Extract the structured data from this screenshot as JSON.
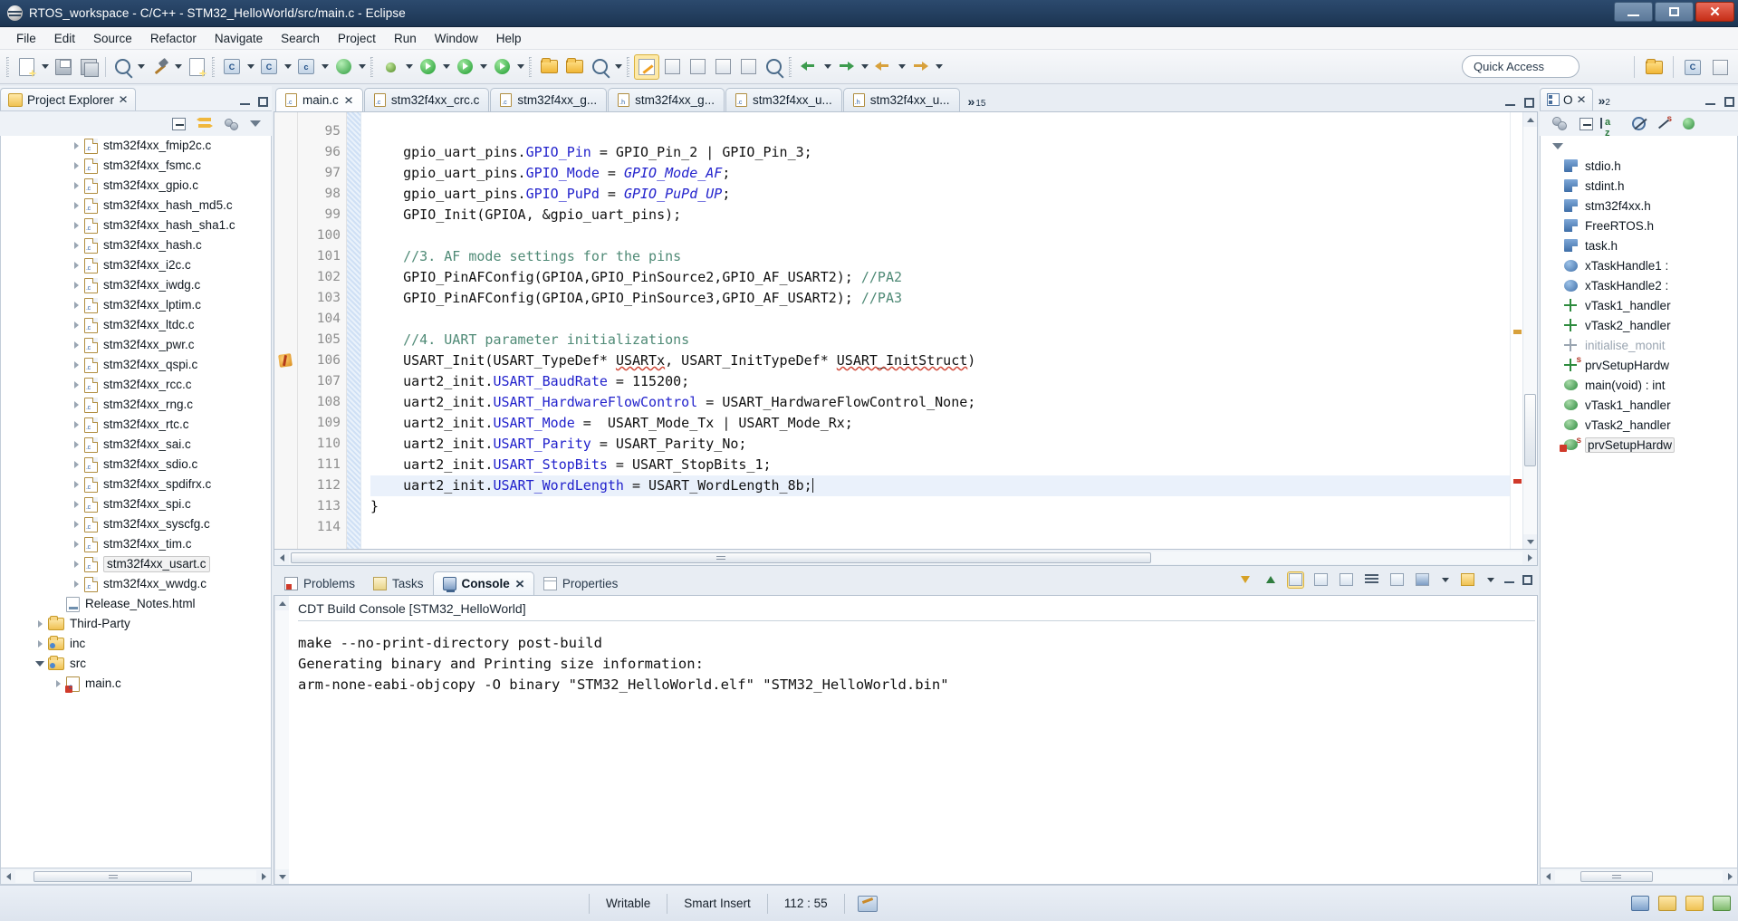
{
  "window": {
    "title": "RTOS_workspace - C/C++ - STM32_HelloWorld/src/main.c - Eclipse",
    "minimize_label": "",
    "maximize_label": "",
    "close_label": "✕"
  },
  "menu": {
    "items": [
      "File",
      "Edit",
      "Source",
      "Refactor",
      "Navigate",
      "Search",
      "Project",
      "Run",
      "Window",
      "Help"
    ]
  },
  "toolbar": {
    "quick_access_placeholder": "Quick Access",
    "buttons": [
      "new-button",
      "save-button",
      "save-all-button",
      "skip-breakpoints-button",
      "build-button",
      "binary-button",
      "new-c-project-button",
      "new-cpp-project-button",
      "new-c-file-button",
      "refresh-button",
      "debug-button",
      "run-button",
      "run-config-button",
      "external-tools-button",
      "open-folder-button",
      "search-folder-button",
      "search-button",
      "toggle-mark-button",
      "next-annotation-button",
      "previous-annotation-button",
      "last-edit-button",
      "back-button",
      "forward-button"
    ]
  },
  "project_explorer": {
    "title": "Project Explorer",
    "close_icon": "✕",
    "toolbar": [
      "collapse-all-icon",
      "link-with-editor-icon",
      "view-menu-icon",
      "view-dropdown-icon"
    ],
    "items": [
      {
        "label": "stm32f4xx_fmip2c.c",
        "indent": 3,
        "type": "c",
        "expandable": true,
        "selected": false
      },
      {
        "label": "stm32f4xx_fsmc.c",
        "indent": 3,
        "type": "c",
        "expandable": true,
        "selected": false
      },
      {
        "label": "stm32f4xx_gpio.c",
        "indent": 3,
        "type": "c",
        "expandable": true,
        "selected": false
      },
      {
        "label": "stm32f4xx_hash_md5.c",
        "indent": 3,
        "type": "c",
        "expandable": true,
        "selected": false
      },
      {
        "label": "stm32f4xx_hash_sha1.c",
        "indent": 3,
        "type": "c",
        "expandable": true,
        "selected": false
      },
      {
        "label": "stm32f4xx_hash.c",
        "indent": 3,
        "type": "c",
        "expandable": true,
        "selected": false
      },
      {
        "label": "stm32f4xx_i2c.c",
        "indent": 3,
        "type": "c",
        "expandable": true,
        "selected": false
      },
      {
        "label": "stm32f4xx_iwdg.c",
        "indent": 3,
        "type": "c",
        "expandable": true,
        "selected": false
      },
      {
        "label": "stm32f4xx_lptim.c",
        "indent": 3,
        "type": "c",
        "expandable": true,
        "selected": false
      },
      {
        "label": "stm32f4xx_ltdc.c",
        "indent": 3,
        "type": "c",
        "expandable": true,
        "selected": false
      },
      {
        "label": "stm32f4xx_pwr.c",
        "indent": 3,
        "type": "c",
        "expandable": true,
        "selected": false
      },
      {
        "label": "stm32f4xx_qspi.c",
        "indent": 3,
        "type": "c",
        "expandable": true,
        "selected": false
      },
      {
        "label": "stm32f4xx_rcc.c",
        "indent": 3,
        "type": "c",
        "expandable": true,
        "selected": false
      },
      {
        "label": "stm32f4xx_rng.c",
        "indent": 3,
        "type": "c",
        "expandable": true,
        "selected": false
      },
      {
        "label": "stm32f4xx_rtc.c",
        "indent": 3,
        "type": "c",
        "expandable": true,
        "selected": false
      },
      {
        "label": "stm32f4xx_sai.c",
        "indent": 3,
        "type": "c",
        "expandable": true,
        "selected": false
      },
      {
        "label": "stm32f4xx_sdio.c",
        "indent": 3,
        "type": "c",
        "expandable": true,
        "selected": false
      },
      {
        "label": "stm32f4xx_spdifrx.c",
        "indent": 3,
        "type": "c",
        "expandable": true,
        "selected": false
      },
      {
        "label": "stm32f4xx_spi.c",
        "indent": 3,
        "type": "c",
        "expandable": true,
        "selected": false
      },
      {
        "label": "stm32f4xx_syscfg.c",
        "indent": 3,
        "type": "c",
        "expandable": true,
        "selected": false
      },
      {
        "label": "stm32f4xx_tim.c",
        "indent": 3,
        "type": "c",
        "expandable": true,
        "selected": false
      },
      {
        "label": "stm32f4xx_usart.c",
        "indent": 3,
        "type": "c",
        "expandable": true,
        "selected": true
      },
      {
        "label": "stm32f4xx_wwdg.c",
        "indent": 3,
        "type": "c",
        "expandable": true,
        "selected": false
      },
      {
        "label": "Release_Notes.html",
        "indent": 2,
        "type": "html",
        "expandable": false,
        "selected": false
      },
      {
        "label": "Third-Party",
        "indent": 1,
        "type": "folder",
        "expandable": true,
        "selected": false
      },
      {
        "label": "inc",
        "indent": 1,
        "type": "folder-src",
        "expandable": true,
        "selected": false
      },
      {
        "label": "src",
        "indent": 1,
        "type": "folder-src",
        "expandable": true,
        "expanded": true,
        "selected": false
      },
      {
        "label": "main.c",
        "indent": 2,
        "type": "c-main",
        "expandable": true,
        "selected": false
      }
    ]
  },
  "editor": {
    "tabs": [
      {
        "label": "main.c",
        "type": "c",
        "active": true,
        "has_close": true
      },
      {
        "label": "stm32f4xx_crc.c",
        "type": "c",
        "active": false,
        "has_close": false
      },
      {
        "label": "stm32f4xx_g...",
        "type": "c",
        "active": false,
        "has_close": false
      },
      {
        "label": "stm32f4xx_g...",
        "type": "h",
        "active": false,
        "has_close": false
      },
      {
        "label": "stm32f4xx_u...",
        "type": "c",
        "active": false,
        "has_close": false
      },
      {
        "label": "stm32f4xx_u...",
        "type": "h",
        "active": false,
        "has_close": false
      }
    ],
    "more_tabs_count": "15",
    "more_tabs_symbol": "»",
    "first_line_number": 95,
    "lines": [
      {
        "n": 95,
        "segments": [],
        "warn": false,
        "hl": false
      },
      {
        "n": 96,
        "segments": [
          {
            "t": "    gpio_uart_pins.",
            "c": "plain"
          },
          {
            "t": "GPIO_Pin",
            "c": "var"
          },
          {
            "t": " = GPIO_Pin_2 | GPIO_Pin_3;",
            "c": "plain"
          }
        ],
        "warn": false,
        "hl": false
      },
      {
        "n": 97,
        "segments": [
          {
            "t": "    gpio_uart_pins.",
            "c": "plain"
          },
          {
            "t": "GPIO_Mode",
            "c": "var"
          },
          {
            "t": " = ",
            "c": "plain"
          },
          {
            "t": "GPIO_Mode_AF",
            "c": "ital"
          },
          {
            "t": ";",
            "c": "plain"
          }
        ],
        "warn": false,
        "hl": false
      },
      {
        "n": 98,
        "segments": [
          {
            "t": "    gpio_uart_pins.",
            "c": "plain"
          },
          {
            "t": "GPIO_PuPd",
            "c": "var"
          },
          {
            "t": " = ",
            "c": "plain"
          },
          {
            "t": "GPIO_PuPd_UP",
            "c": "ital"
          },
          {
            "t": ";",
            "c": "plain"
          }
        ],
        "warn": false,
        "hl": false
      },
      {
        "n": 99,
        "segments": [
          {
            "t": "    GPIO_Init(GPIOA, &gpio_uart_pins);",
            "c": "plain"
          }
        ],
        "warn": false,
        "hl": false
      },
      {
        "n": 100,
        "segments": [],
        "warn": false,
        "hl": false
      },
      {
        "n": 101,
        "segments": [
          {
            "t": "    //3. AF mode settings for the pins",
            "c": "com"
          }
        ],
        "warn": false,
        "hl": false
      },
      {
        "n": 102,
        "segments": [
          {
            "t": "    GPIO_PinAFConfig(GPIOA,GPIO_PinSource2,GPIO_AF_USART2); ",
            "c": "plain"
          },
          {
            "t": "//PA2",
            "c": "com"
          }
        ],
        "warn": false,
        "hl": false
      },
      {
        "n": 103,
        "segments": [
          {
            "t": "    GPIO_PinAFConfig(GPIOA,GPIO_PinSource3,GPIO_AF_USART2); ",
            "c": "plain"
          },
          {
            "t": "//PA3",
            "c": "com"
          }
        ],
        "warn": false,
        "hl": false
      },
      {
        "n": 104,
        "segments": [],
        "warn": false,
        "hl": false
      },
      {
        "n": 105,
        "segments": [
          {
            "t": "    //4. UART parameter initializations",
            "c": "com"
          }
        ],
        "warn": false,
        "hl": false
      },
      {
        "n": 106,
        "segments": [
          {
            "t": "    USART_Init(USART_TypeDef* ",
            "c": "plain"
          },
          {
            "t": "USARTx",
            "c": "squig"
          },
          {
            "t": ", USART_InitTypeDef* ",
            "c": "plain"
          },
          {
            "t": "USART_InitStruct",
            "c": "squig"
          },
          {
            "t": ")",
            "c": "plain"
          }
        ],
        "warn": true,
        "hl": false
      },
      {
        "n": 107,
        "segments": [
          {
            "t": "    uart2_init.",
            "c": "plain"
          },
          {
            "t": "USART_BaudRate",
            "c": "var"
          },
          {
            "t": " = 115200;",
            "c": "plain"
          }
        ],
        "warn": false,
        "hl": false
      },
      {
        "n": 108,
        "segments": [
          {
            "t": "    uart2_init.",
            "c": "plain"
          },
          {
            "t": "USART_HardwareFlowControl",
            "c": "var"
          },
          {
            "t": " = USART_HardwareFlowControl_None;",
            "c": "plain"
          }
        ],
        "warn": false,
        "hl": false
      },
      {
        "n": 109,
        "segments": [
          {
            "t": "    uart2_init.",
            "c": "plain"
          },
          {
            "t": "USART_Mode",
            "c": "var"
          },
          {
            "t": " =  USART_Mode_Tx | USART_Mode_Rx;",
            "c": "plain"
          }
        ],
        "warn": false,
        "hl": false
      },
      {
        "n": 110,
        "segments": [
          {
            "t": "    uart2_init.",
            "c": "plain"
          },
          {
            "t": "USART_Parity",
            "c": "var"
          },
          {
            "t": " = USART_Parity_No;",
            "c": "plain"
          }
        ],
        "warn": false,
        "hl": false
      },
      {
        "n": 111,
        "segments": [
          {
            "t": "    uart2_init.",
            "c": "plain"
          },
          {
            "t": "USART_StopBits",
            "c": "var"
          },
          {
            "t": " = USART_StopBits_1;",
            "c": "plain"
          }
        ],
        "warn": false,
        "hl": false
      },
      {
        "n": 112,
        "segments": [
          {
            "t": "    uart2_init.",
            "c": "plain"
          },
          {
            "t": "USART_WordLength",
            "c": "var"
          },
          {
            "t": " = USART_WordLength_8b;",
            "c": "plain"
          }
        ],
        "warn": false,
        "hl": true,
        "caret": true
      },
      {
        "n": 113,
        "segments": [
          {
            "t": "}",
            "c": "plain"
          }
        ],
        "warn": false,
        "hl": false
      },
      {
        "n": 114,
        "segments": [],
        "warn": false,
        "hl": false
      }
    ]
  },
  "console": {
    "tabs": [
      {
        "label": "Problems",
        "icon": "problems-icon",
        "active": false
      },
      {
        "label": "Tasks",
        "icon": "tasks-icon",
        "active": false
      },
      {
        "label": "Console",
        "icon": "console-icon",
        "active": true,
        "close_icon": "✕"
      },
      {
        "label": "Properties",
        "icon": "properties-icon",
        "active": false
      }
    ],
    "header": "CDT Build Console [STM32_HelloWorld]",
    "output": [
      "make --no-print-directory post-build",
      "Generating binary and Printing size information:",
      "arm-none-eabi-objcopy -O binary \"STM32_HelloWorld.elf\" \"STM32_HelloWorld.bin\""
    ],
    "toolbar_icons": [
      "scroll-lock-down-icon",
      "scroll-lock-up-icon",
      "pin-console-icon",
      "clear-console-icon",
      "show-console-icon",
      "display-selected-icon",
      "open-console-icon",
      "new-console-view-icon",
      "pin-icon",
      "minimize-icon",
      "maximize-icon"
    ]
  },
  "outline": {
    "title": "O",
    "close_icon": "✕",
    "more_count": "2",
    "more_symbol": "»",
    "toolbar": [
      "group-icon",
      "collapse-all-icon",
      "sort-az-icon",
      "hide-fields-icon",
      "hide-static-icon",
      "hide-nonpublic-icon"
    ],
    "items": [
      {
        "label": "stdio.h",
        "type": "include",
        "dim": false,
        "sel": false
      },
      {
        "label": "stdint.h",
        "type": "include",
        "dim": false,
        "sel": false
      },
      {
        "label": "stm32f4xx.h",
        "type": "include",
        "dim": false,
        "sel": false
      },
      {
        "label": "FreeRTOS.h",
        "type": "include",
        "dim": false,
        "sel": false
      },
      {
        "label": "task.h",
        "type": "include",
        "dim": false,
        "sel": false
      },
      {
        "label": "xTaskHandle1 :",
        "type": "variable",
        "dim": false,
        "sel": false
      },
      {
        "label": "xTaskHandle2 :",
        "type": "variable",
        "dim": false,
        "sel": false
      },
      {
        "label": "vTask1_handler",
        "type": "prototype",
        "dim": false,
        "sel": false
      },
      {
        "label": "vTask2_handler",
        "type": "prototype",
        "dim": false,
        "sel": false
      },
      {
        "label": "initialise_monit",
        "type": "prototype-disabled",
        "dim": true,
        "sel": false
      },
      {
        "label": "prvSetupHardw",
        "type": "prototype-static",
        "dim": false,
        "sel": false
      },
      {
        "label": "main(void) : int",
        "type": "function",
        "dim": false,
        "sel": false
      },
      {
        "label": "vTask1_handler",
        "type": "function",
        "dim": false,
        "sel": false
      },
      {
        "label": "vTask2_handler",
        "type": "function",
        "dim": false,
        "sel": false
      },
      {
        "label": "prvSetupHardw",
        "type": "function-static-marked",
        "dim": false,
        "sel": true
      }
    ]
  },
  "statusbar": {
    "writable": "Writable",
    "insert_mode": "Smart Insert",
    "cursor_position": "112 : 55"
  },
  "colors": {
    "title_bar": "#2c4a6e",
    "accent": "#2222cc",
    "comment": "#4f8a76",
    "error_squiggle": "#d04a3a",
    "selection": "#eaf1fb"
  }
}
